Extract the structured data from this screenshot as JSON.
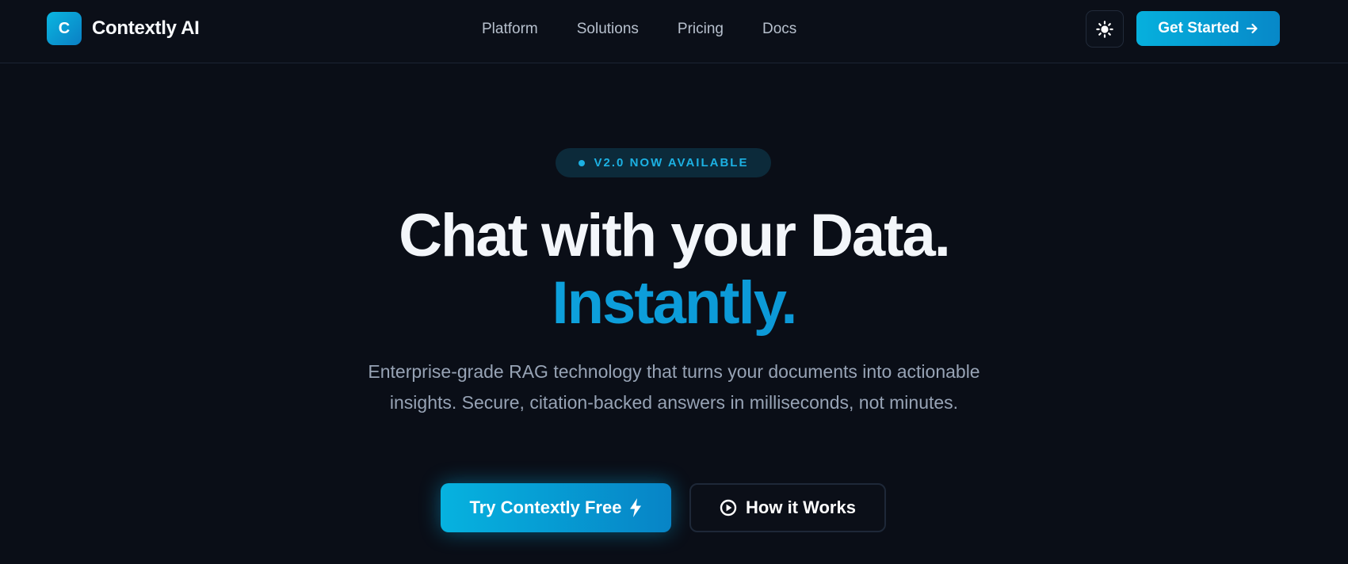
{
  "header": {
    "brand": {
      "logo_letter": "C",
      "name": "Contextly AI"
    },
    "nav": [
      {
        "label": "Platform"
      },
      {
        "label": "Solutions"
      },
      {
        "label": "Pricing"
      },
      {
        "label": "Docs"
      }
    ],
    "theme_toggle_icon": "sun-icon",
    "cta_label": "Get Started",
    "cta_icon": "arrow-right-icon"
  },
  "hero": {
    "badge": "V2.0 NOW AVAILABLE",
    "headline": "Chat with your Data.",
    "headline_accent": "Instantly.",
    "subtitle": "Enterprise-grade RAG technology that turns your documents into actionable insights. Secure, citation-backed answers in milliseconds, not minutes.",
    "primary_cta": "Try Contextly Free",
    "primary_cta_icon": "lightning-bolt-icon",
    "secondary_cta": "How it Works",
    "secondary_cta_icon": "play-circle-icon"
  },
  "colors": {
    "background": "#0a0e17",
    "accent": "#0ea5df",
    "accent_dark": "#0784c6",
    "text_primary": "#f3f6fa",
    "text_muted": "#97a3b5",
    "badge_bg": "#0c2a3a"
  }
}
